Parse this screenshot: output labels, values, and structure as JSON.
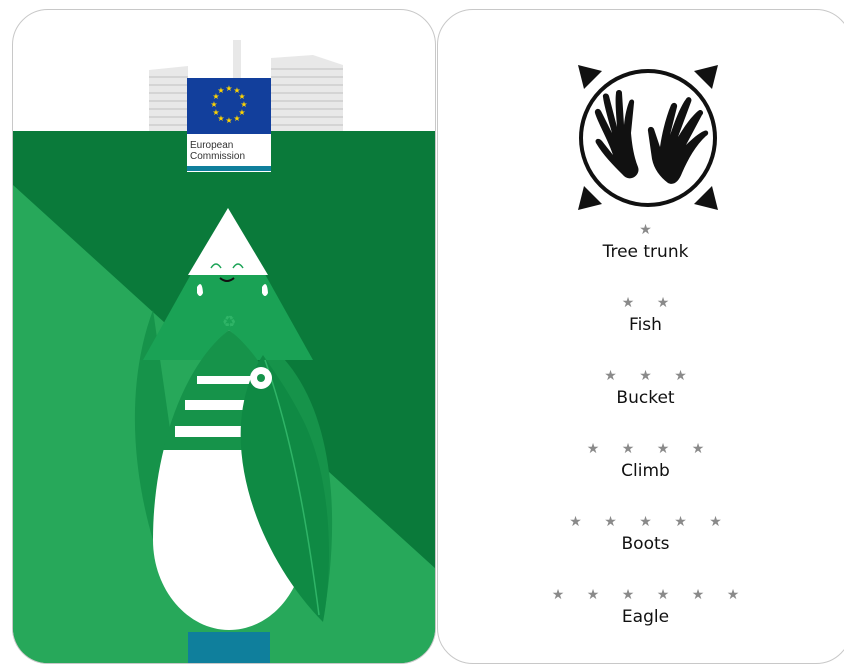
{
  "front": {
    "org_name": "European Commission",
    "colors": {
      "dark_green": "#0a7a3a",
      "mid_green": "#149a4b",
      "light_green": "#27a85a",
      "eu_blue": "#123f9c",
      "eu_star": "#ffd400",
      "teal": "#0f7f9c"
    }
  },
  "back": {
    "icon": "two-hands-icon",
    "levels": [
      {
        "stars": "★",
        "label": "Tree trunk"
      },
      {
        "stars": "★ ★",
        "label": "Fish"
      },
      {
        "stars": "★ ★ ★",
        "label": "Bucket"
      },
      {
        "stars": "★ ★ ★ ★",
        "label": "Climb"
      },
      {
        "stars": "★ ★ ★ ★ ★",
        "label": "Boots"
      },
      {
        "stars": "★ ★ ★ ★ ★ ★",
        "label": "Eagle"
      }
    ]
  }
}
